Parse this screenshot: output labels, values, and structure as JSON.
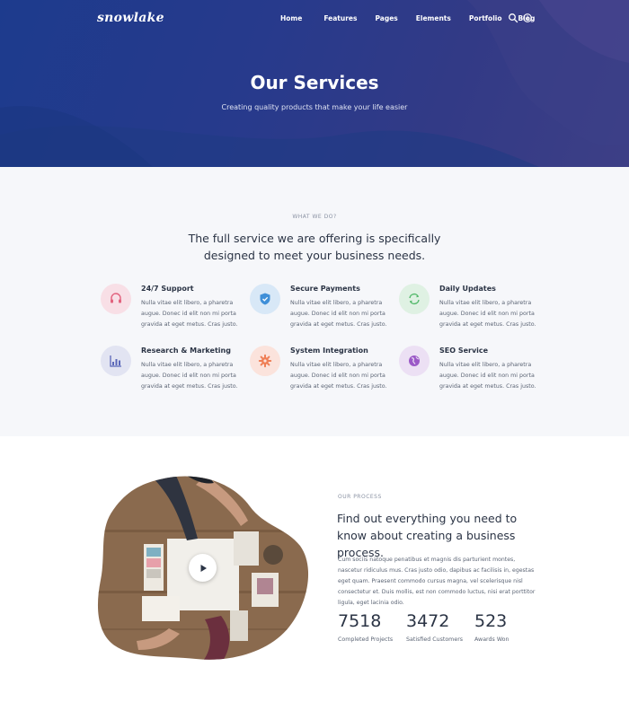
{
  "header": {
    "logo": "snowlake",
    "nav": [
      "Home",
      "Features",
      "Pages",
      "Elements",
      "Portfolio",
      "Blog"
    ],
    "icons": [
      "search-icon",
      "info-icon"
    ]
  },
  "hero": {
    "title": "Our Services",
    "subtitle": "Creating quality products that make your life easier"
  },
  "services": {
    "eyebrow": "WHAT WE DO?",
    "heading_line1": "The full service we are offering is specifically",
    "heading_line2": "designed to meet your business needs.",
    "items": [
      {
        "title": "24/7 Support",
        "desc": "Nulla vitae elit libero, a pharetra augue. Donec id elit non mi porta gravida at eget metus. Cras justo.",
        "icon": "headset-icon",
        "bg": "#f8dfe6",
        "color": "#e2627e"
      },
      {
        "title": "Secure Payments",
        "desc": "Nulla vitae elit libero, a pharetra augue. Donec id elit non mi porta gravida at eget metus. Cras justo.",
        "icon": "shield-icon",
        "bg": "#d8e8f7",
        "color": "#3f8fd8"
      },
      {
        "title": "Daily Updates",
        "desc": "Nulla vitae elit libero, a pharetra augue. Donec id elit non mi porta gravida at eget metus. Cras justo.",
        "icon": "refresh-icon",
        "bg": "#dff1e3",
        "color": "#54b96b"
      },
      {
        "title": "Research & Marketing",
        "desc": "Nulla vitae elit libero, a pharetra augue. Donec id elit non mi porta gravida at eget metus. Cras justo.",
        "icon": "chart-icon",
        "bg": "#e2e4f2",
        "color": "#5a67b8"
      },
      {
        "title": "System Integration",
        "desc": "Nulla vitae elit libero, a pharetra augue. Donec id elit non mi porta gravida at eget metus. Cras justo.",
        "icon": "gear-icon",
        "bg": "#fbe3dc",
        "color": "#ef7f56"
      },
      {
        "title": "SEO Service",
        "desc": "Nulla vitae elit libero, a pharetra augue. Donec id elit non mi porta gravida at eget metus. Cras justo.",
        "icon": "globe-icon",
        "bg": "#ece0f4",
        "color": "#9b59c7"
      }
    ]
  },
  "process": {
    "eyebrow": "OUR PROCESS",
    "heading": "Find out everything you need to know about creating a business process.",
    "text": "Cum sociis natoque penatibus et magnis dis parturient montes, nascetur ridiculus mus. Cras justo odio, dapibus ac facilisis in, egestas eget quam. Praesent commodo cursus magna, vel scelerisque nisl consectetur et. Duis mollis, est non commodo luctus, nisi erat porttitor ligula, eget lacinia odio.",
    "stats": [
      {
        "num": "7518",
        "label": "Completed Projects"
      },
      {
        "num": "3472",
        "label": "Satisfied Customers"
      },
      {
        "num": "523",
        "label": "Awards Won"
      }
    ]
  }
}
